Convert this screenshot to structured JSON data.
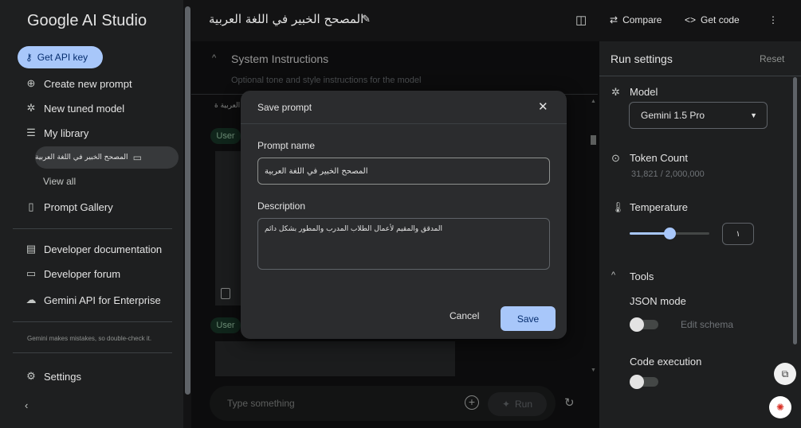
{
  "sidebar": {
    "logo": "Google AI Studio",
    "api_key_label": "Get API key",
    "create_prompt": "Create new prompt",
    "new_tuned_model": "New tuned model",
    "my_library": "My library",
    "library_item": "المصحح الخبير في اللغة العربية",
    "view_all": "View all",
    "prompt_gallery": "Prompt Gallery",
    "dev_docs": "Developer documentation",
    "dev_forum": "Developer forum",
    "enterprise": "Gemini API for Enterprise",
    "disclaimer": "Gemini makes mistakes, so double-check it.",
    "settings": "Settings"
  },
  "topbar": {
    "title": "المصحح الخبير في اللغة العربية",
    "compare": "Compare",
    "get_code": "Get code"
  },
  "main": {
    "system_instructions": "System Instructions",
    "system_hint": "Optional tone and style instructions for the model",
    "snippet": "العربية ة",
    "user_label": "User",
    "composer_placeholder": "Type something",
    "run_label": "Run"
  },
  "run_settings": {
    "title": "Run settings",
    "reset": "Reset",
    "model_label": "Model",
    "model_value": "Gemini 1.5 Pro",
    "token_label": "Token Count",
    "token_value": "31,821 / 2,000,000",
    "temperature_label": "Temperature",
    "temperature_value": "١",
    "temperature_level": 0.5,
    "tools_label": "Tools",
    "json_mode": "JSON mode",
    "edit_schema": "Edit schema",
    "code_execution": "Code execution"
  },
  "modal": {
    "title": "Save prompt",
    "name_label": "Prompt name",
    "name_value": "المصحح الخبير في اللغة العربية",
    "description_label": "Description",
    "description_value": "المدقق والمقيم لأعمال الطلاب المدرب والمطور بشكل دائم",
    "cancel": "Cancel",
    "save": "Save"
  },
  "colors": {
    "accent": "#a8c7fa",
    "background": "#131314",
    "panel": "#1e1f20",
    "modal": "#2b2c2e"
  }
}
